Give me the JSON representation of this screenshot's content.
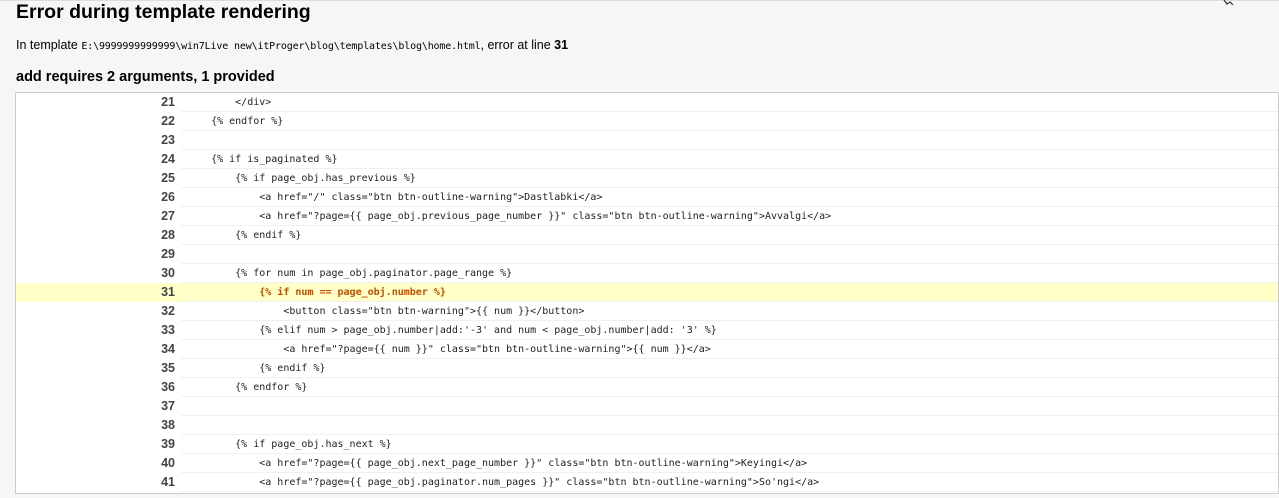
{
  "page": {
    "title": "Error during template rendering",
    "info_prefix": "In template ",
    "template_path": "E:\\9999999999999\\win7Live new\\itProger\\blog\\templates\\blog\\home.html",
    "info_middle": ", error at line ",
    "error_line": "31",
    "error_message": "add requires 2 arguments, 1 provided"
  },
  "source": {
    "active_line": 31,
    "lines": [
      {
        "num": "21",
        "code": "        </div>"
      },
      {
        "num": "22",
        "code": "    {% endfor %}"
      },
      {
        "num": "23",
        "code": ""
      },
      {
        "num": "24",
        "code": "    {% if is_paginated %}"
      },
      {
        "num": "25",
        "code": "        {% if page_obj.has_previous %}"
      },
      {
        "num": "26",
        "code": "            <a href=\"/\" class=\"btn btn-outline-warning\">Dastlabki</a>"
      },
      {
        "num": "27",
        "code": "            <a href=\"?page={{ page_obj.previous_page_number }}\" class=\"btn btn-outline-warning\">Avvalgi</a>"
      },
      {
        "num": "28",
        "code": "        {% endif %}"
      },
      {
        "num": "29",
        "code": ""
      },
      {
        "num": "30",
        "code": "        {% for num in page_obj.paginator.page_range %}"
      },
      {
        "num": "31",
        "code": "            {% if num == page_obj.number %}"
      },
      {
        "num": "32",
        "code": "                <button class=\"btn btn-warning\">{{ num }}</button>"
      },
      {
        "num": "33",
        "code": "            {% elif num > page_obj.number|add:'-3' and num < page_obj.number|add: '3' %}"
      },
      {
        "num": "34",
        "code": "                <a href=\"?page={{ num }}\" class=\"btn btn-outline-warning\">{{ num }}</a>"
      },
      {
        "num": "35",
        "code": "            {% endif %}"
      },
      {
        "num": "36",
        "code": "        {% endfor %}"
      },
      {
        "num": "37",
        "code": ""
      },
      {
        "num": "38",
        "code": ""
      },
      {
        "num": "39",
        "code": "        {% if page_obj.has_next %}"
      },
      {
        "num": "40",
        "code": "            <a href=\"?page={{ page_obj.next_page_number }}\" class=\"btn btn-outline-warning\">Keyingi</a>"
      },
      {
        "num": "41",
        "code": "            <a href=\"?page={{ page_obj.paginator.num_pages }}\" class=\"btn btn-outline-warning\">So'ngi</a>"
      }
    ]
  }
}
